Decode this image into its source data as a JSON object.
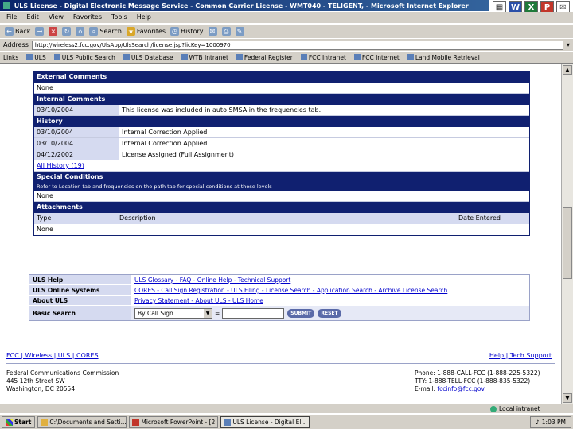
{
  "window": {
    "title": "ULS License - Digital Electronic Message Service - Common Carrier License - WMT040 - TELIGENT, - Microsoft Internet Explorer",
    "apps": [
      "W",
      "X",
      "P"
    ]
  },
  "menu": [
    "File",
    "Edit",
    "View",
    "Favorites",
    "Tools",
    "Help"
  ],
  "toolbar": {
    "back": "Back",
    "search": "Search",
    "favorites": "Favorites",
    "history": "History"
  },
  "address": {
    "label": "Address",
    "url": "http://wireless2.fcc.gov/UlsApp/UlsSearch/license.jsp?licKey=1000970"
  },
  "links": {
    "label": "Links",
    "items": [
      "ULS",
      "ULS Public Search",
      "ULS Database",
      "WTB Intranet",
      "Federal Register",
      "FCC Intranet",
      "FCC Internet",
      "Land Mobile Retrieval"
    ]
  },
  "license": {
    "external_comments": {
      "title": "External Comments",
      "value": "None"
    },
    "internal_comments": {
      "title": "Internal Comments",
      "date": "03/10/2004",
      "text": "This license was included in auto SMSA in the frequencies tab."
    },
    "history": {
      "title": "History",
      "rows": [
        {
          "date": "03/10/2004",
          "event": "Internal Correction Applied"
        },
        {
          "date": "03/10/2004",
          "event": "Internal Correction Applied"
        },
        {
          "date": "04/12/2002",
          "event": "License Assigned (Full Assignment)"
        }
      ],
      "all_link": "All History (19)"
    },
    "special_conditions": {
      "title": "Special Conditions",
      "note": "Refer to Location tab and frequencies on the path tab for special conditions at those levels",
      "value": "None"
    },
    "attachments": {
      "title": "Attachments",
      "col_type": "Type",
      "col_desc": "Description",
      "col_date": "Date Entered",
      "value": "None"
    }
  },
  "help": {
    "rows": [
      {
        "label": "ULS Help",
        "links": "ULS Glossary - FAQ - Online Help - Technical Support"
      },
      {
        "label": "ULS Online Systems",
        "links": "CORES - Call Sign Registration - ULS Filing - License Search - Application Search - Archive License Search"
      },
      {
        "label": "About ULS",
        "links": "Privacy Statement - About ULS - ULS Home"
      }
    ],
    "search_label": "Basic Search",
    "select_value": "By Call Sign",
    "equals": "=",
    "submit": "SUBMIT",
    "reset": "RESET"
  },
  "footer": {
    "left_links": "FCC | Wireless | ULS | CORES",
    "right_links": "Help | Tech Support",
    "org": "Federal Communications Commission",
    "street": "445 12th Street SW",
    "city": "Washington, DC 20554",
    "phone": "Phone: 1-888-CALL-FCC (1-888-225-5322)",
    "tty": "TTY: 1-888-TELL-FCC (1-888-835-5322)",
    "email_label": "E-mail:",
    "email": "fccinfo@fcc.gov"
  },
  "status": {
    "zone": "Local intranet"
  },
  "taskbar": {
    "start": "Start",
    "tasks": [
      "C:\\Documents and Setti...",
      "Microsoft PowerPoint - [2...",
      "ULS License - Digital El..."
    ],
    "clock": "1:03 PM"
  }
}
